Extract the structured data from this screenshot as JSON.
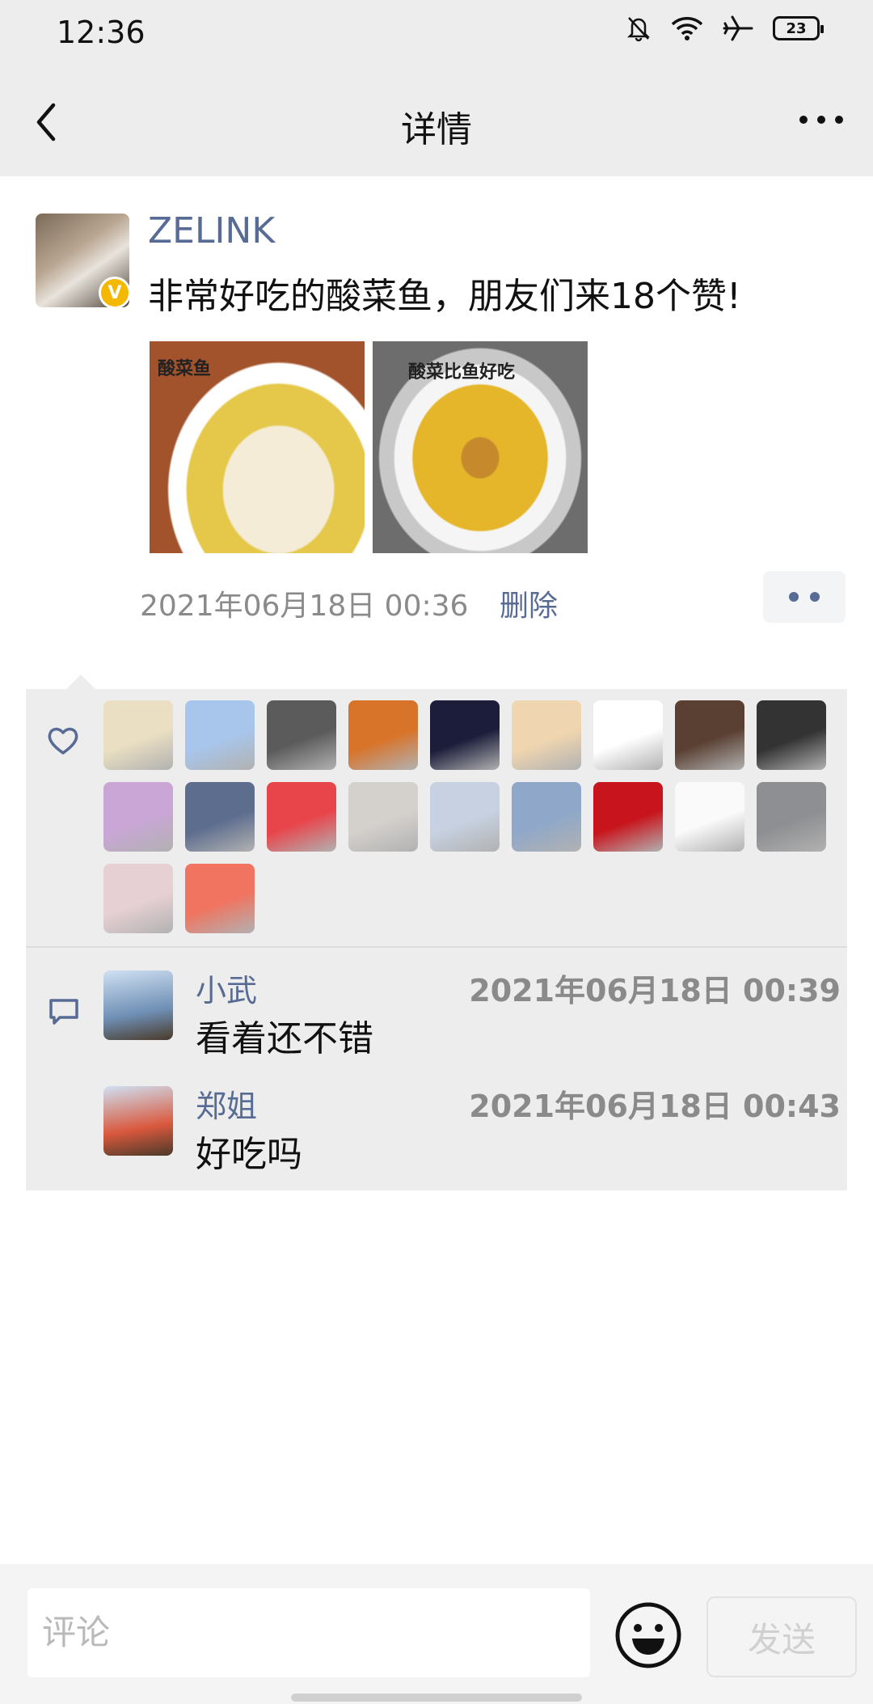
{
  "status_bar": {
    "time": "12:36",
    "battery": "23"
  },
  "nav": {
    "title": "详情",
    "back_icon": "chevron-left-icon",
    "more_icon": "more-dots-icon"
  },
  "post": {
    "username": "ZELINK",
    "verified_badge": "V",
    "text": "非常好吃的酸菜鱼，朋友们来18个赞!",
    "photos": [
      {
        "caption": "酸菜鱼"
      },
      {
        "caption": "酸菜比鱼好吃"
      }
    ],
    "timestamp": "2021年06月18日 00:36",
    "delete_label": "删除"
  },
  "likes": {
    "icon": "heart-icon",
    "avatar_colors": [
      "#eadfc2",
      "#a8c6ec",
      "#5b5b5b",
      "#d8732a",
      "#1b1d3a",
      "#f0d6b0",
      "#ffffff",
      "#5a4033",
      "#333333",
      "#c9a6d6",
      "#5d6d8e",
      "#e8454b",
      "#d4d0cc",
      "#c7d1e1",
      "#8fa8c9",
      "#c8141c",
      "#fafafa",
      "#8e8f92",
      "#e6d0d3",
      "#f07460"
    ]
  },
  "comments": {
    "icon": "comment-icon",
    "items": [
      {
        "name": "小武",
        "time": "2021年06月18日 00:39",
        "text": "看着还不错",
        "avatar_color": "#6f8fb5"
      },
      {
        "name": "郑姐",
        "time": "2021年06月18日 00:43",
        "text": "好吃吗",
        "avatar_color": "#d9583d"
      }
    ]
  },
  "composer": {
    "placeholder": "评论",
    "send_label": "发送",
    "emoji_icon": "smiley-icon"
  }
}
